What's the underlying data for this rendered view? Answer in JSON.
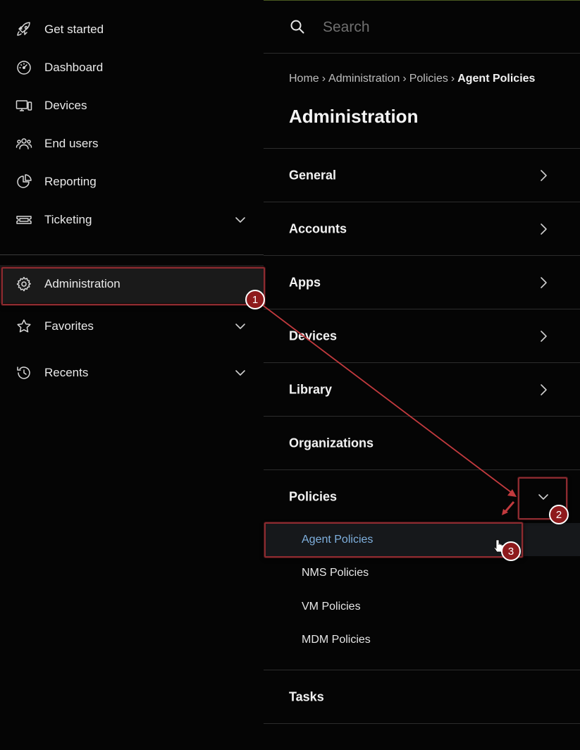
{
  "sidebar": {
    "items": [
      {
        "label": "Get started",
        "icon": "rocket-icon"
      },
      {
        "label": "Dashboard",
        "icon": "gauge-icon"
      },
      {
        "label": "Devices",
        "icon": "devices-icon"
      },
      {
        "label": "End users",
        "icon": "users-icon"
      },
      {
        "label": "Reporting",
        "icon": "pie-chart-icon"
      },
      {
        "label": "Ticketing",
        "icon": "ticket-icon",
        "expandable": true
      }
    ],
    "admin": {
      "label": "Administration",
      "icon": "gear-icon"
    },
    "favorites": {
      "label": "Favorites",
      "icon": "star-icon"
    },
    "recents": {
      "label": "Recents",
      "icon": "history-icon"
    }
  },
  "search": {
    "placeholder": "Search"
  },
  "breadcrumb": {
    "home": "Home",
    "administration": "Administration",
    "policies": "Policies",
    "current": "Agent Policies"
  },
  "page_title": "Administration",
  "sections": [
    {
      "label": "General",
      "chevron": "right"
    },
    {
      "label": "Accounts",
      "chevron": "right"
    },
    {
      "label": "Apps",
      "chevron": "right"
    },
    {
      "label": "Devices",
      "chevron": "right"
    },
    {
      "label": "Library",
      "chevron": "right"
    },
    {
      "label": "Organizations",
      "chevron": "none"
    },
    {
      "label": "Policies",
      "chevron": "down"
    },
    {
      "label": "Tasks",
      "chevron": "none"
    }
  ],
  "policies_submenu": [
    {
      "label": "Agent Policies",
      "active": true
    },
    {
      "label": "NMS Policies"
    },
    {
      "label": "VM Policies"
    },
    {
      "label": "MDM Policies"
    }
  ],
  "annotations": {
    "step1": "1",
    "step2": "2",
    "step3": "3",
    "highlight_color": "#8c2b30",
    "badge_color": "#8e1a1c"
  },
  "colors": {
    "background": "#050505",
    "active_link": "#7fb0de"
  }
}
